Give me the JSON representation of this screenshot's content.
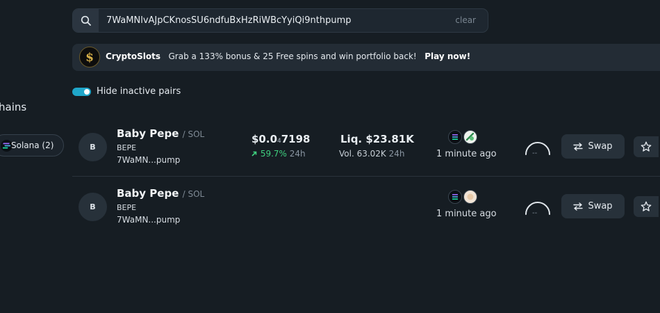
{
  "search": {
    "value": "7WaMNlvAJpCKnosSU6ndfuBxHzRiWBcYyiQi9nthpump",
    "clear_label": "clear",
    "icon": "search-icon"
  },
  "banner": {
    "brand": "CryptoSlots",
    "text": "Grab a 133% bonus & 25 Free spins and win portfolio back!",
    "cta": "Play now!",
    "logo": "cryptoslots-logo"
  },
  "filter": {
    "hide_inactive_label": "Hide inactive pairs",
    "hide_inactive_on": true,
    "accent": "#1fa6c9"
  },
  "sidebar": {
    "chains_title": "hains",
    "chain_chip_label": "Solana (2)"
  },
  "pairs": [
    {
      "avatar": "B",
      "name": "Baby Pepe",
      "quote": "/ SOL",
      "symbol": "BEPE",
      "address": "7WaMN...pump",
      "price_main": "$0.0",
      "price_sub": "4",
      "price_tail": "7198",
      "change": "59.7%",
      "change_period": "24h",
      "liquidity": "Liq. $23.81K",
      "volume": "Vol. 63.02K",
      "volume_period": "24h",
      "time": "1 minute ago",
      "gauge": "--",
      "swap_label": "Swap"
    },
    {
      "avatar": "B",
      "name": "Baby Pepe",
      "quote": "/ SOL",
      "symbol": "BEPE",
      "address": "7WaMN...pump",
      "time": "1 minute ago",
      "gauge": "--",
      "swap_label": "Swap"
    }
  ],
  "colors": {
    "background": "#161d23",
    "positive": "#3fcf7f",
    "panel": "#27313a"
  }
}
